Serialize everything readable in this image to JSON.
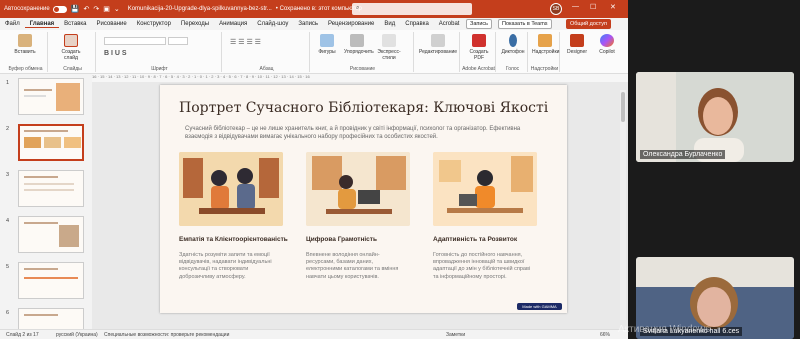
{
  "titlebar": {
    "autosave_label": "Автосохранение",
    "doc_title": "Komunikacija-20-Upgrade-dlya-spilkuvannya-bez-str...",
    "save_status": "• Сохранено в: этот компьютер",
    "search_placeholder": "",
    "user_initials": "SB",
    "minimize": "—",
    "maximize": "☐",
    "close": "✕"
  },
  "tabs": [
    "Файл",
    "Главная",
    "Вставка",
    "Рисование",
    "Конструктор",
    "Переходы",
    "Анимация",
    "Слайд-шоу",
    "Запись",
    "Рецензирование",
    "Вид",
    "Справка",
    "Acrobat"
  ],
  "tab_actions": {
    "record": "Запись",
    "teams": "Показать в Teams",
    "share": "Общий доступ"
  },
  "ribbon": {
    "paste": "Вставить",
    "new_slide": "Создать слайд",
    "shapes": "Фигуры",
    "arrange": "Упорядочить",
    "quick_styles": "Экспресс-стили",
    "editing": "Редактирование",
    "create_pdf": "Создать PDF",
    "dictate": "Диктофон",
    "addins": "Надстройки",
    "designer": "Designer",
    "copilot": "Copilot",
    "groups": {
      "clipboard": "Буфер обмена",
      "slides": "Слайды",
      "font": "Шрифт",
      "paragraph": "Абзац",
      "drawing": "Рисование",
      "acrobat": "Adobe Acrobat",
      "voice": "Голос",
      "addins": "Надстройки"
    }
  },
  "thumbnails": {
    "numbers": [
      "1",
      "2",
      "3",
      "4",
      "5",
      "6"
    ]
  },
  "ruler": "16 · 15 · 14 · 13 · 12 · 11 · 10 · 9 · 8 · 7 · 6 · 5 · 4 · 3 · 2 · 1 · 0 · 1 · 2 · 3 · 4 · 5 · 6 · 7 · 8 · 9 · 10 · 11 · 12 · 13 · 14 · 15 · 16",
  "slide": {
    "title": "Портрет Сучасного Бібліотекаря: Ключові Якості",
    "intro": "Сучасний бібліотекар – це не лише хранитель книг, а й провідник у світі інформації, психолог та організатор. Ефективна взаємодія з відвідувачами вимагає унікального набору професійних та особистих якостей.",
    "columns": [
      {
        "heading": "Емпатія та Клієнтоорієнтованість",
        "text": "Здатність розуміти запити та емоції відвідувачів, надавати індивідуальні консультації та створювати доброзичливу атмосферу."
      },
      {
        "heading": "Цифрова Грамотність",
        "text": "Впевнене володіння онлайн-ресурсами, базами даних, електронними каталогами та вміння навчати цьому користувачів."
      },
      {
        "heading": "Адаптивність та Розвиток",
        "text": "Готовність до постійного навчання, впровадження інновацій та швидкої адаптації до змін у бібліотечній справі та інформаційному просторі."
      }
    ],
    "made_with": "Made with GAMMA"
  },
  "statusbar": {
    "slide_of": "Слайд 2 из 17",
    "language": "русский (Украина)",
    "accessibility": "Специальные возможности: проверьте рекомендации",
    "notes": "Заметки",
    "zoom": "66%"
  },
  "video": {
    "participant1": "Олександра Бурлаченко",
    "participant2": "Svitlana Lukyanenko hall 6.ces"
  },
  "watermark": "Активация Windows",
  "colors": {
    "accent": "#c43e1c",
    "slide_bg": "#fbf6f1",
    "title": "#3b2c24"
  }
}
